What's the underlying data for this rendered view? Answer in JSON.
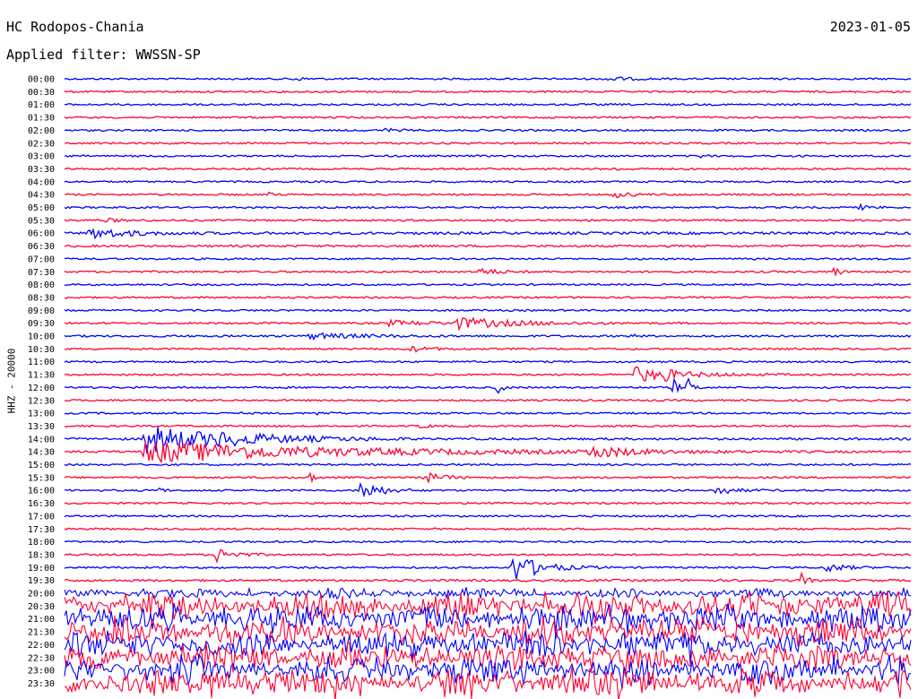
{
  "header": {
    "station": "HC Rodopos-Chania",
    "date": "2023-01-05",
    "filter": "Applied filter: WWSSN-SP"
  },
  "chart_data": {
    "type": "line",
    "title": "HC Rodopos-Chania",
    "subtitle": "Applied filter: WWSSN-SP",
    "date": "2023-01-05",
    "ylabel": "HHZ - 20000",
    "xlabel": "",
    "series_colors": [
      "#0000ff",
      "#ff0033"
    ],
    "rows": [
      {
        "label": "00:00",
        "noise": 1.0,
        "events": [
          {
            "x": 0.27,
            "amp": 2,
            "dur": 0.015
          },
          {
            "x": 0.64,
            "amp": 3,
            "dur": 0.02
          }
        ]
      },
      {
        "label": "00:30",
        "noise": 1.0,
        "events": []
      },
      {
        "label": "01:00",
        "noise": 1.0,
        "events": []
      },
      {
        "label": "01:30",
        "noise": 1.0,
        "events": []
      },
      {
        "label": "02:00",
        "noise": 1.0,
        "events": [
          {
            "x": 0.38,
            "amp": 2,
            "dur": 0.012
          }
        ]
      },
      {
        "label": "02:30",
        "noise": 1.0,
        "events": []
      },
      {
        "label": "03:00",
        "noise": 1.0,
        "events": [
          {
            "x": 0.75,
            "amp": 2,
            "dur": 0.008
          }
        ]
      },
      {
        "label": "03:30",
        "noise": 1.0,
        "events": [
          {
            "x": 0.65,
            "amp": 1.5,
            "dur": 0.01
          }
        ]
      },
      {
        "label": "04:00",
        "noise": 1.0,
        "events": []
      },
      {
        "label": "04:30",
        "noise": 1.0,
        "events": [
          {
            "x": 0.24,
            "amp": 2,
            "dur": 0.008
          },
          {
            "x": 0.65,
            "amp": 3,
            "dur": 0.02
          }
        ]
      },
      {
        "label": "05:00",
        "noise": 1.0,
        "events": [
          {
            "x": 0.94,
            "amp": 2.5,
            "dur": 0.01
          }
        ]
      },
      {
        "label": "05:30",
        "noise": 1.0,
        "events": [
          {
            "x": 0.05,
            "amp": 2,
            "dur": 0.015
          }
        ]
      },
      {
        "label": "06:00",
        "noise": 1.4,
        "events": [
          {
            "x": 0.03,
            "amp": 6,
            "dur": 0.04
          }
        ]
      },
      {
        "label": "06:30",
        "noise": 1.2,
        "events": []
      },
      {
        "label": "07:00",
        "noise": 1.0,
        "events": []
      },
      {
        "label": "07:30",
        "noise": 1.0,
        "events": [
          {
            "x": 0.49,
            "amp": 4,
            "dur": 0.02
          },
          {
            "x": 0.91,
            "amp": 7,
            "dur": 0.006
          }
        ]
      },
      {
        "label": "08:00",
        "noise": 1.0,
        "events": []
      },
      {
        "label": "08:30",
        "noise": 1.0,
        "events": []
      },
      {
        "label": "09:00",
        "noise": 1.0,
        "events": []
      },
      {
        "label": "09:30",
        "noise": 1.0,
        "events": [
          {
            "x": 0.38,
            "amp": 3,
            "dur": 0.05
          },
          {
            "x": 0.46,
            "amp": 6,
            "dur": 0.07
          }
        ]
      },
      {
        "label": "10:00",
        "noise": 1.1,
        "events": [
          {
            "x": 0.29,
            "amp": 3,
            "dur": 0.06
          },
          {
            "x": 0.67,
            "amp": 2,
            "dur": 0.006
          }
        ]
      },
      {
        "label": "10:30",
        "noise": 1.0,
        "events": [
          {
            "x": 0.41,
            "amp": 3,
            "dur": 0.02
          }
        ]
      },
      {
        "label": "11:00",
        "noise": 1.0,
        "events": []
      },
      {
        "label": "11:30",
        "noise": 1.0,
        "events": [
          {
            "x": 0.67,
            "amp": 9,
            "dur": 0.05
          },
          {
            "x": 0.71,
            "amp": 4,
            "dur": 0.006
          }
        ]
      },
      {
        "label": "12:00",
        "noise": 1.0,
        "events": [
          {
            "x": 0.51,
            "amp": 8,
            "dur": 0.006
          },
          {
            "x": 0.72,
            "amp": 9,
            "dur": 0.006
          },
          {
            "x": 0.737,
            "amp": 9,
            "dur": 0.006
          }
        ]
      },
      {
        "label": "12:30",
        "noise": 1.0,
        "events": []
      },
      {
        "label": "13:00",
        "noise": 1.0,
        "events": [
          {
            "x": 0.3,
            "amp": 2,
            "dur": 0.01
          }
        ]
      },
      {
        "label": "13:30",
        "noise": 1.0,
        "events": [
          {
            "x": 0.42,
            "amp": 2,
            "dur": 0.01
          }
        ]
      },
      {
        "label": "14:00",
        "noise": 1.2,
        "events": [
          {
            "x": 0.095,
            "amp": 16,
            "dur": 0.08
          },
          {
            "x": 0.18,
            "amp": 3,
            "dur": 0.08
          }
        ]
      },
      {
        "label": "14:30",
        "noise": 1.2,
        "events": [
          {
            "x": 0.095,
            "amp": 12,
            "dur": 0.2
          },
          {
            "x": 0.62,
            "amp": 7,
            "dur": 0.04
          }
        ]
      },
      {
        "label": "15:00",
        "noise": 1.0,
        "events": []
      },
      {
        "label": "15:30",
        "noise": 1.0,
        "events": [
          {
            "x": 0.29,
            "amp": 7,
            "dur": 0.004
          },
          {
            "x": 0.42,
            "amp": 8,
            "dur": 0.02
          }
        ]
      },
      {
        "label": "16:00",
        "noise": 1.0,
        "events": [
          {
            "x": 0.11,
            "amp": 8,
            "dur": 0.004
          },
          {
            "x": 0.35,
            "amp": 12,
            "dur": 0.02
          },
          {
            "x": 0.77,
            "amp": 5,
            "dur": 0.02
          }
        ]
      },
      {
        "label": "16:30",
        "noise": 1.0,
        "events": [
          {
            "x": 0.49,
            "amp": 2,
            "dur": 0.01
          }
        ]
      },
      {
        "label": "17:00",
        "noise": 1.0,
        "events": []
      },
      {
        "label": "17:30",
        "noise": 1.0,
        "events": []
      },
      {
        "label": "18:00",
        "noise": 1.0,
        "events": []
      },
      {
        "label": "18:30",
        "noise": 1.0,
        "events": [
          {
            "x": 0.18,
            "amp": 8,
            "dur": 0.02
          }
        ]
      },
      {
        "label": "19:00",
        "noise": 1.0,
        "events": [
          {
            "x": 0.53,
            "amp": 16,
            "dur": 0.03
          },
          {
            "x": 0.9,
            "amp": 5,
            "dur": 0.02
          }
        ]
      },
      {
        "label": "19:30",
        "noise": 1.2,
        "events": [
          {
            "x": 0.87,
            "amp": 8,
            "dur": 0.006
          }
        ]
      },
      {
        "label": "20:00",
        "noise": 5.0,
        "events": []
      },
      {
        "label": "20:30",
        "noise": 14.0,
        "events": []
      },
      {
        "label": "21:00",
        "noise": 14.0,
        "events": []
      },
      {
        "label": "21:30",
        "noise": 14.0,
        "events": []
      },
      {
        "label": "22:00",
        "noise": 14.0,
        "events": []
      },
      {
        "label": "22:30",
        "noise": 14.0,
        "events": []
      },
      {
        "label": "23:00",
        "noise": 14.0,
        "events": []
      },
      {
        "label": "23:30",
        "noise": 14.0,
        "events": []
      }
    ]
  }
}
